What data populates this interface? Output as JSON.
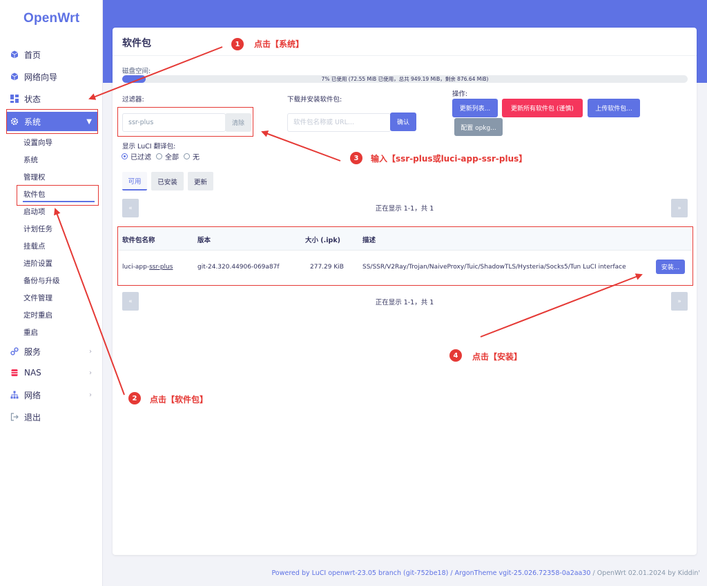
{
  "sidebar": {
    "logo": "OpenWrt",
    "items": [
      {
        "label": "首页",
        "icon": "cube-icon"
      },
      {
        "label": "网络向导",
        "icon": "cube-icon"
      },
      {
        "label": "状态",
        "icon": "dashboard-icon"
      },
      {
        "label": "系统",
        "icon": "gear-icon"
      },
      {
        "label": "服务",
        "icon": "link-icon"
      },
      {
        "label": "NAS",
        "icon": "database-icon"
      },
      {
        "label": "网络",
        "icon": "network-icon"
      },
      {
        "label": "退出",
        "icon": "logout-icon"
      }
    ],
    "system_sub": [
      "设置向导",
      "系统",
      "管理权",
      "软件包",
      "启动项",
      "计划任务",
      "挂载点",
      "进阶设置",
      "备份与升级",
      "文件管理",
      "定时重启",
      "重启"
    ]
  },
  "page": {
    "title": "软件包",
    "disk_label": "磁盘空间:",
    "disk_text": "7% 已使用 (72.55 MiB 已使用，总共 949.19 MiB，剩余 876.64 MiB)",
    "disk_percent": 7,
    "filter_label": "过滤器:",
    "filter_value": "ssr-plus",
    "clear_label": "清除",
    "download_label": "下载并安装软件包:",
    "download_placeholder": "软件包名称或 URL...",
    "confirm_label": "确认",
    "actions_label": "操作:",
    "update_lists_label": "更新列表...",
    "upgrade_all_label": "更新所有软件包 (谨慎)",
    "upload_label": "上传软件包...",
    "configure_label": "配置 opkg...",
    "luci_lang_label": "显示 LuCI 翻译包:",
    "radio_filtered": "已过滤",
    "radio_all": "全部",
    "radio_none": "无",
    "tab_available": "可用",
    "tab_installed": "已安装",
    "tab_updates": "更新",
    "prev_label": "«",
    "next_label": "»",
    "pager_text": "正在显示 1-1，共 1",
    "columns": {
      "name": "软件包名称",
      "version": "版本",
      "size": "大小 (.ipk)",
      "desc": "描述"
    },
    "row": {
      "name_prefix": "luci-app-",
      "name_link": "ssr-plus",
      "version": "git-24.320.44906-069a87f",
      "size": "277.29 KiB",
      "desc": "SS/SSR/V2Ray/Trojan/NaiveProxy/Tuic/ShadowTLS/Hysteria/Socks5/Tun LuCI interface",
      "install_label": "安装..."
    }
  },
  "annotations": {
    "a1_num": "1",
    "a1_text": "点击【系统】",
    "a2_num": "2",
    "a2_text": "点击【软件包】",
    "a3_num": "3",
    "a3_text": "输入【ssr-plus或luci-app-ssr-plus】",
    "a4_num": "4",
    "a4_text": "点击【安装】",
    "color": "#e53935"
  },
  "footer": {
    "text_a": "Powered by LuCI openwrt-23.05 branch (git-752be18) / ArgonTheme v",
    "text_b": "git-25.026.72358-0a2aa30",
    "text_c": " / OpenWrt 02.01.2024 by Kiddin'"
  },
  "colors": {
    "accent": "#5e72e4",
    "danger": "#f5365c",
    "annotation": "#e53935"
  }
}
